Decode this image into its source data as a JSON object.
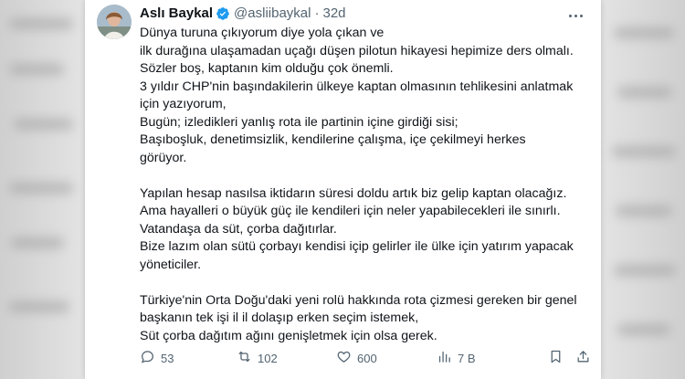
{
  "tweet": {
    "author_name": "Aslı Baykal",
    "handle": "@asliibaykal",
    "separator": "·",
    "time": "32d",
    "paragraphs": [
      [
        "Dünya turuna çıkıyorum diye yola çıkan ve",
        "ilk durağına ulaşamadan uçağı düşen pilotun hikayesi hepimize ders olmalı.",
        "Sözler boş, kaptanın kim olduğu çok önemli.",
        "3 yıldır CHP'nin başındakilerin ülkeye kaptan olmasının tehlikesini anlatmak",
        "için yazıyorum,",
        "Bugün; izledikleri yanlış rota ile partinin içine girdiği sisi;",
        "Başıboşluk, denetimsizlik, kendilerine çalışma, içe çekilmeyi herkes",
        "görüyor."
      ],
      [
        "Yapılan hesap nasılsa iktidarın süresi doldu artık biz gelip kaptan olacağız.",
        "Ama hayalleri o büyük güç ile kendileri için neler yapabilecekleri ile sınırlı.",
        "Vatandaşa da süt, çorba dağıtırlar.",
        "Bize lazım olan sütü çorbayı kendisi içip gelirler ile ülke için yatırım yapacak",
        "yöneticiler."
      ],
      [
        "Türkiye'nin Orta Doğu'daki yeni rolü hakkında rota çizmesi gereken bir genel",
        "başkanın tek işi il il dolaşıp erken seçim istemek,",
        "Süt çorba dağıtım ağını genişletmek için olsa gerek."
      ]
    ]
  },
  "actions": {
    "replies": "53",
    "retweets": "102",
    "likes": "600",
    "views": "7 B"
  },
  "colors": {
    "text": "#0f1419",
    "muted": "#536471",
    "verified": "#1d9bf0"
  }
}
